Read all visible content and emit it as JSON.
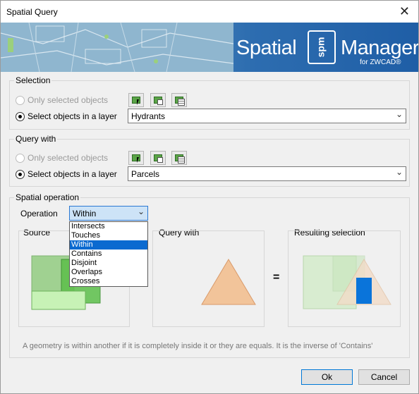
{
  "window": {
    "title": "Spatial Query"
  },
  "banner": {
    "brand_left": "Spatial",
    "logo_text": "spm",
    "brand_right": "Manager",
    "subtitle": "for ZWCAD®"
  },
  "selection": {
    "label": "Selection",
    "opt_selected": "Only selected objects",
    "opt_layer": "Select objects in a layer",
    "layer_value": "Hydrants"
  },
  "query_with": {
    "label": "Query with",
    "opt_selected": "Only selected objects",
    "opt_layer": "Select objects in a layer",
    "layer_value": "Parcels"
  },
  "spatial_operation": {
    "label": "Spatial operation",
    "operation_label": "Operation",
    "operation_value": "Within",
    "options": [
      "Intersects",
      "Touches",
      "Within",
      "Contains",
      "Disjoint",
      "Overlaps",
      "Crosses"
    ],
    "selected_index": 2,
    "panels": {
      "source": "Source",
      "query_with": "Query with",
      "result": "Resulting selection"
    },
    "equals_sign": "=",
    "description": "A geometry is within another if it is completely inside it or they are equals. It is the inverse of 'Contains'"
  },
  "buttons": {
    "ok": "Ok",
    "cancel": "Cancel"
  },
  "colors": {
    "accent": "#0b6ad0",
    "green": "#5aa447",
    "orange": "#f2c49a",
    "blue": "#0a74da"
  }
}
